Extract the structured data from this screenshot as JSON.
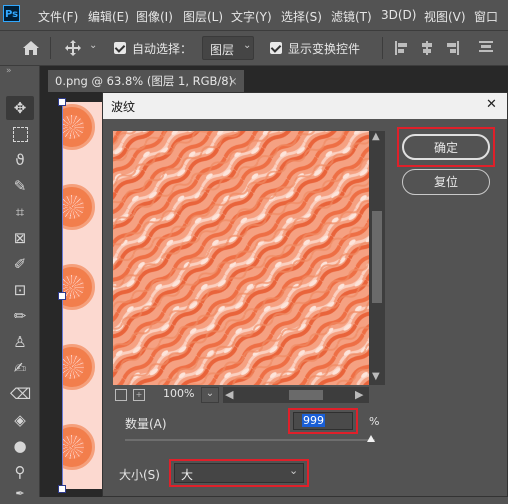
{
  "app": {
    "logo": "Ps"
  },
  "menu": [
    "文件(F)",
    "编辑(E)",
    "图像(I)",
    "图层(L)",
    "文字(Y)",
    "选择(S)",
    "滤镜(T)",
    "3D(D)",
    "视图(V)",
    "窗口"
  ],
  "options": {
    "auto_select_label": "自动选择：",
    "auto_select_value": "图层",
    "show_transform_label": "显示变换控件"
  },
  "document": {
    "tab_title": "0.png @ 63.8% (图层 1, RGB/8)",
    "close_glyph": "×"
  },
  "dialog": {
    "title": "波纹",
    "close_glyph": "✕",
    "ok_label": "确定",
    "reset_label": "复位",
    "zoom": "100%",
    "amount_label": "数量(A)",
    "amount_value": "999",
    "amount_unit": "%",
    "size_label": "大小(S)",
    "size_value": "大"
  },
  "colors": {
    "accent_red": "#e0202a",
    "preview_base": "#f7a887",
    "selection_blue": "#1a5fd6"
  }
}
